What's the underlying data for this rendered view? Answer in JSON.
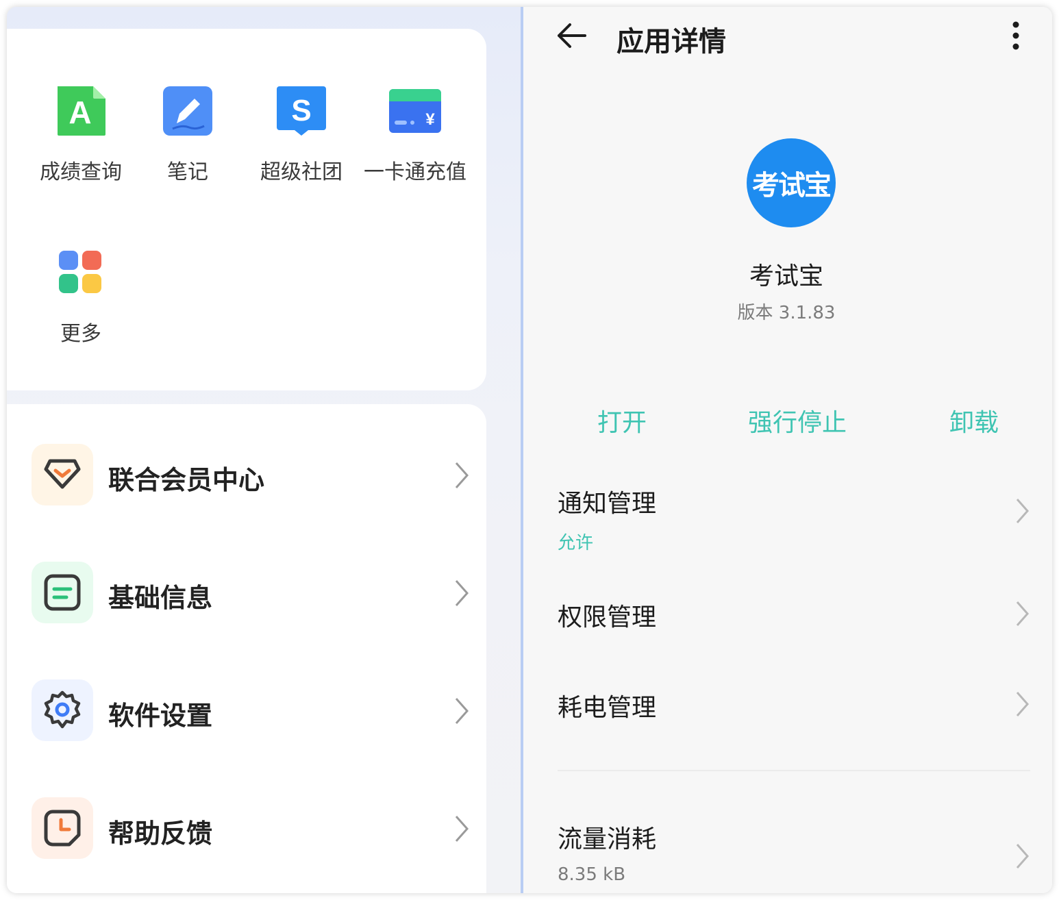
{
  "left": {
    "apps": [
      {
        "label": "成绩查询",
        "icon": "grade-a-icon"
      },
      {
        "label": "笔记",
        "icon": "note-pen-icon"
      },
      {
        "label": "超级社团",
        "icon": "club-s-icon"
      },
      {
        "label": "一卡通充值",
        "icon": "card-recharge-icon"
      },
      {
        "label": "更多",
        "icon": "more-grid-icon"
      }
    ],
    "menu": [
      {
        "label": "联合会员中心",
        "icon": "member-heart-icon"
      },
      {
        "label": "基础信息",
        "icon": "info-card-icon"
      },
      {
        "label": "软件设置",
        "icon": "settings-gear-icon"
      },
      {
        "label": "帮助反馈",
        "icon": "feedback-clock-icon"
      }
    ],
    "colors": {
      "app_green": "#3fca5a",
      "app_blue": "#4f8ff7",
      "member_bg": "#fff5e6",
      "info_bg": "#e8fbef",
      "settings_bg": "#eef3ff",
      "feedback_bg": "#fff0e8"
    }
  },
  "right": {
    "header": {
      "title": "应用详情"
    },
    "app": {
      "icon_text": "考试宝",
      "name": "考试宝",
      "version": "版本 3.1.83"
    },
    "actions": {
      "open": "打开",
      "force_stop": "强行停止",
      "uninstall": "卸载"
    },
    "settings": [
      {
        "title": "通知管理",
        "sub": "允许"
      },
      {
        "title": "权限管理"
      },
      {
        "title": "耗电管理"
      },
      {
        "title": "流量消耗",
        "sub": "8.35 kB"
      }
    ],
    "colors": {
      "accent": "#3fc4b2",
      "app_icon_bg": "#1e8cf0"
    }
  }
}
